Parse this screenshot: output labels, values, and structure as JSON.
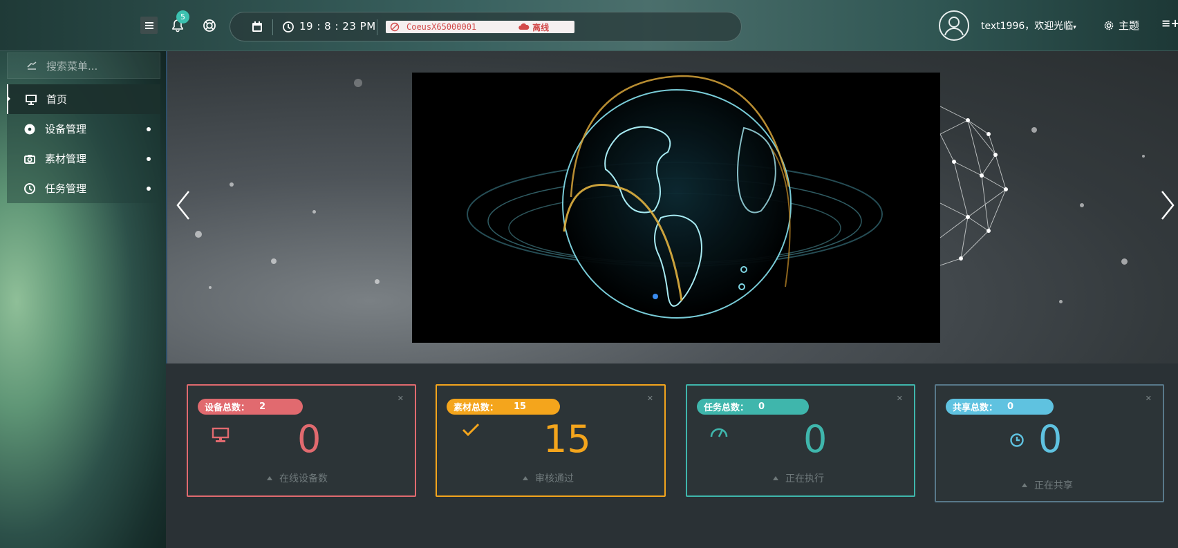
{
  "topbar": {
    "notification_count": "5",
    "time": "19 : 8 : 23 PM",
    "device_id": "CoeusX65000001",
    "device_status": "离线",
    "user_greeting": "text1996，欢迎光临",
    "theme_label": "主题"
  },
  "sidebar": {
    "search_placeholder": "搜索菜单...",
    "items": [
      {
        "label": "首页",
        "icon": "monitor-icon",
        "active": true
      },
      {
        "label": "设备管理",
        "icon": "disc-icon"
      },
      {
        "label": "素材管理",
        "icon": "camera-icon"
      },
      {
        "label": "任务管理",
        "icon": "clock-icon"
      }
    ]
  },
  "cards": [
    {
      "pill_label": "设备总数：",
      "pill_value": "2",
      "big": "0",
      "desc": "在线设备数",
      "color": "#e16a6f",
      "icon": "monitor-icon"
    },
    {
      "pill_label": "素材总数：",
      "pill_value": "15",
      "big": "15",
      "desc": "审核通过",
      "color": "#f4a51c",
      "icon": "check-icon"
    },
    {
      "pill_label": "任务总数：",
      "pill_value": "0",
      "big": "0",
      "desc": "正在执行",
      "color": "#3fb6ac",
      "icon": "gauge-icon"
    },
    {
      "pill_label": "共享总数：",
      "pill_value": "0",
      "big": "0",
      "desc": "正在共享",
      "color": "#5fc2e0",
      "icon": "clock-icon"
    }
  ],
  "colors": {
    "offline_red": "#d24a4a",
    "badge_teal": "#3cc1b0"
  }
}
